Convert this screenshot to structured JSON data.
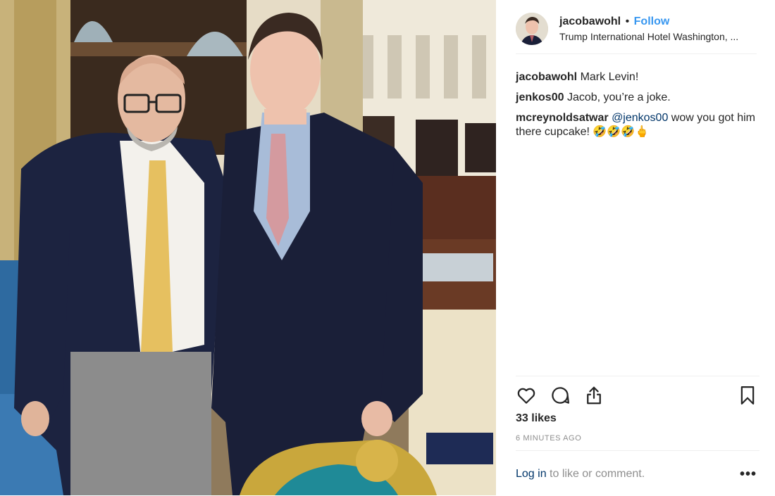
{
  "post": {
    "username": "jacobawohl",
    "separator": "•",
    "follow_label": "Follow",
    "location": "Trump International Hotel Washington, ..."
  },
  "comments": [
    {
      "user": "jacobawohl",
      "text": "Mark Levin!"
    },
    {
      "user": "jenkos00",
      "text": "Jacob, you’re a joke."
    },
    {
      "user": "mcreynoldsatwar",
      "mention": "@jenkos00",
      "text": " wow you got him there cupcake! 🤣🤣🤣🖕"
    }
  ],
  "actions": {
    "like_icon": "heart-icon",
    "comment_icon": "comment-icon",
    "share_icon": "share-icon",
    "save_icon": "bookmark-icon"
  },
  "likes_text": "33 likes",
  "timestamp": "6 MINUTES AGO",
  "footer": {
    "login_label": "Log in",
    "login_suffix": " to like or comment.",
    "more_label": "•••"
  },
  "colors": {
    "link_blue": "#3897f0",
    "dark_link": "#003569",
    "muted": "#8e8e8e"
  }
}
